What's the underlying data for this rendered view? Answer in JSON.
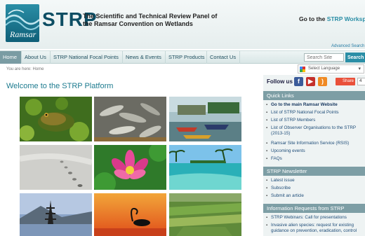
{
  "header": {
    "logo_text": "Ramsar",
    "brand": "STRP",
    "panel_title": "The Scientific and Technical Review Panel of the Ramsar Convention on Wetlands",
    "workspace_prefix": "Go to the",
    "workspace_highlight": "STRP Workspac"
  },
  "nav": {
    "items": [
      "Home",
      "About Us",
      "STRP National Focal Points",
      "News & Events",
      "STRP Products",
      "Contact Us"
    ],
    "active": "Home"
  },
  "search": {
    "advanced_label": "Advanced Search",
    "placeholder": "Search Site",
    "button_label": "Search"
  },
  "breadcrumb": "You are here: Home",
  "language": {
    "label": "Select Language"
  },
  "main": {
    "welcome_title": "Welcome to the STRP Platform"
  },
  "sidebar": {
    "follow_label": "Follow us",
    "share_label": "Share",
    "share_count": "4",
    "quick_links": {
      "title": "Quick Links",
      "items": [
        "Go to the main Ramsar Website",
        "List of STRP National Focal Points",
        "List of STRP Members",
        "List of Observer Organisations to the STRP (2013-15)",
        "Ramsar Site Information Service (RSIS)",
        "Upcoming events",
        "FAQs"
      ]
    },
    "newsletter": {
      "title": "STRP Newsletter",
      "items": [
        "Latest issue",
        "Subscribe",
        "Submit an article"
      ]
    },
    "requests": {
      "title": "Information Requests from STRP",
      "items": [
        "STRP Webinars: Call for presentations",
        "Invasive alien species: request for existing guidance on prevention, eradication, control"
      ]
    }
  },
  "colors": {
    "brand": "#0d4d63",
    "accent": "#2a8ea6",
    "nav_active": "#7a9ca3",
    "section_header": "#7d9ea5",
    "share": "#e9503a"
  }
}
